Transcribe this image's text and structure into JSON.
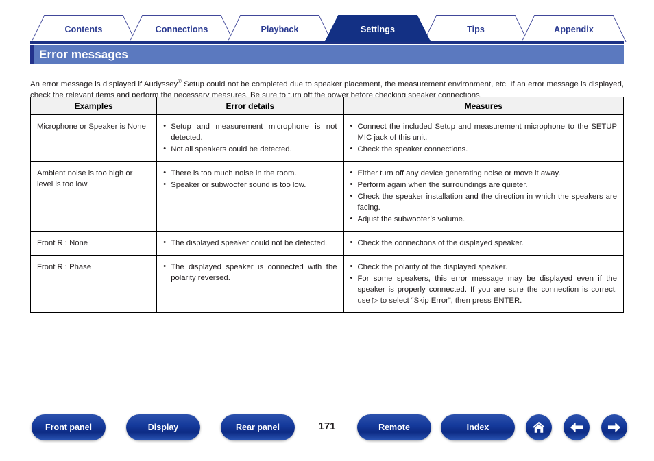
{
  "nav": {
    "tabs": [
      {
        "label": "Contents",
        "active": false
      },
      {
        "label": "Connections",
        "active": false
      },
      {
        "label": "Playback",
        "active": false
      },
      {
        "label": "Settings",
        "active": true
      },
      {
        "label": "Tips",
        "active": false
      },
      {
        "label": "Appendix",
        "active": false
      }
    ],
    "active_color": "#133084",
    "inactive_text_color": "#2a3a91",
    "underline_color": "#1c3184"
  },
  "section": {
    "title": "Error messages",
    "bar_color": "#5b79bf",
    "accent_color": "#23328c"
  },
  "intro": {
    "part1": "An error message is displayed if Audyssey",
    "registered_mark": "®",
    "part2": " Setup could not be completed due to speaker placement, the measurement environment, etc. If an error message is displayed, check the relevant items and perform the necessary measures. Be sure to turn off the power before checking speaker connections."
  },
  "table": {
    "headers": [
      "Examples",
      "Error details",
      "Measures"
    ],
    "rows": [
      {
        "example": "Microphone or Speaker is None",
        "details": [
          "Setup and measurement microphone is not detected.",
          "Not all speakers could be detected."
        ],
        "measures": [
          "Connect the included Setup and measurement microphone to the SETUP MIC jack of this unit.",
          "Check the speaker connections."
        ]
      },
      {
        "example": "Ambient noise is too high or level is too low",
        "details": [
          "There is too much noise in the room.",
          "Speaker or subwoofer sound is too low."
        ],
        "measures": [
          "Either turn off any device generating noise or move it away.",
          "Perform again when the surroundings are quieter.",
          "Check the speaker installation and the direction in which the speakers are facing.",
          "Adjust the subwoofer’s volume."
        ]
      },
      {
        "example": "Front R : None",
        "details": [
          "The displayed speaker could not be detected."
        ],
        "measures": [
          "Check the connections of the displayed speaker."
        ]
      },
      {
        "example": "Front R : Phase",
        "details": [
          "The displayed speaker is connected with the polarity reversed."
        ],
        "measures": [
          "Check the polarity of the displayed speaker.",
          "For some speakers, this error message may be displayed even if the speaker is properly connected. If you are sure the connection is correct, use ▷ to select “Skip Error”, then press ENTER."
        ]
      }
    ]
  },
  "footer": {
    "buttons": [
      {
        "label": "Front panel"
      },
      {
        "label": "Display"
      },
      {
        "label": "Rear panel"
      },
      {
        "label": "Remote"
      },
      {
        "label": "Index"
      }
    ],
    "page_number": "171",
    "icons": [
      {
        "name": "home-icon"
      },
      {
        "name": "arrow-left-icon"
      },
      {
        "name": "arrow-right-icon"
      }
    ],
    "button_color": "#153a9b"
  }
}
